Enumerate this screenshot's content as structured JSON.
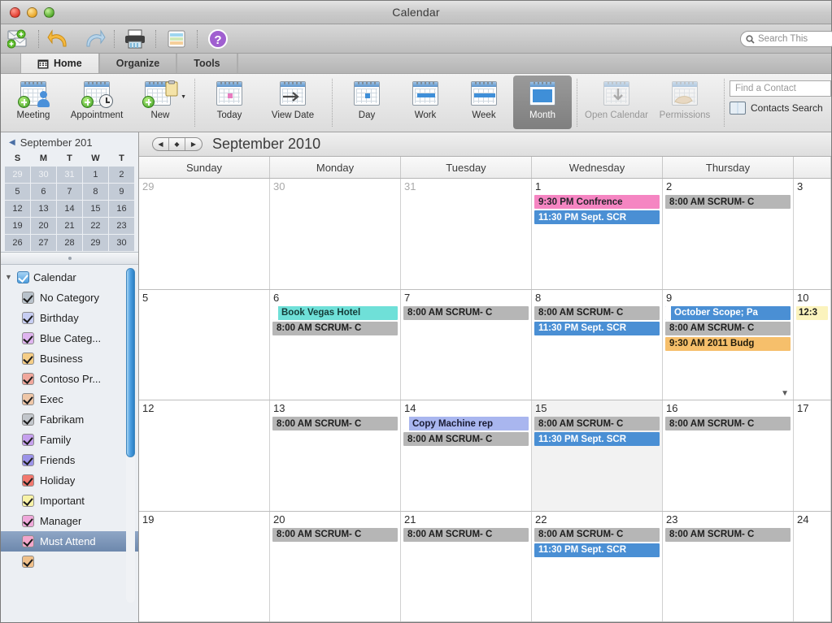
{
  "window": {
    "title": "Calendar",
    "traffic_lights": [
      "close-button",
      "minimize-button",
      "zoom-button"
    ]
  },
  "quick_toolbar": {
    "items": [
      {
        "name": "send-receive-icon",
        "label": "Send / Receive"
      },
      {
        "name": "undo-icon",
        "label": "Undo"
      },
      {
        "name": "redo-icon",
        "label": "Redo"
      },
      {
        "name": "print-icon",
        "label": "Print"
      },
      {
        "name": "categories-icon",
        "label": "Categories"
      },
      {
        "name": "help-icon",
        "label": "Help"
      }
    ],
    "search_placeholder": "Search This"
  },
  "tabs": [
    {
      "label": "Home",
      "active": true
    },
    {
      "label": "Organize",
      "active": false
    },
    {
      "label": "Tools",
      "active": false
    }
  ],
  "ribbon": {
    "groups": [
      {
        "items": [
          {
            "label": "Meeting",
            "icon": "new-meeting-icon",
            "state": "enabled"
          },
          {
            "label": "Appointment",
            "icon": "new-appointment-icon",
            "state": "enabled"
          },
          {
            "label": "New",
            "icon": "new-item-icon",
            "state": "enabled",
            "has_dropdown": true
          }
        ]
      },
      {
        "items": [
          {
            "label": "Today",
            "icon": "today-icon",
            "state": "enabled"
          },
          {
            "label": "View Date",
            "icon": "view-date-icon",
            "state": "enabled"
          }
        ]
      },
      {
        "items": [
          {
            "label": "Day",
            "icon": "day-view-icon",
            "state": "enabled"
          },
          {
            "label": "Work",
            "icon": "work-week-view-icon",
            "state": "enabled"
          },
          {
            "label": "Week",
            "icon": "week-view-icon",
            "state": "enabled"
          },
          {
            "label": "Month",
            "icon": "month-view-icon",
            "state": "selected"
          }
        ]
      },
      {
        "items": [
          {
            "label": "Open Calendar",
            "icon": "open-calendar-icon",
            "state": "disabled"
          },
          {
            "label": "Permissions",
            "icon": "permissions-icon",
            "state": "disabled"
          }
        ]
      }
    ],
    "find_contact_placeholder": "Find a Contact",
    "contacts_search_label": "Contacts Search"
  },
  "sidebar": {
    "mini_calendar": {
      "title": "September 201",
      "prev_label": "◀",
      "weekday_headers": [
        "S",
        "M",
        "T",
        "W",
        "T"
      ],
      "weeks": [
        [
          {
            "d": "29",
            "other": true
          },
          {
            "d": "30",
            "other": true
          },
          {
            "d": "31",
            "other": true
          },
          {
            "d": "1"
          },
          {
            "d": "2"
          }
        ],
        [
          {
            "d": "5"
          },
          {
            "d": "6"
          },
          {
            "d": "7"
          },
          {
            "d": "8"
          },
          {
            "d": "9"
          }
        ],
        [
          {
            "d": "12"
          },
          {
            "d": "13"
          },
          {
            "d": "14"
          },
          {
            "d": "15"
          },
          {
            "d": "16"
          }
        ],
        [
          {
            "d": "19"
          },
          {
            "d": "20"
          },
          {
            "d": "21"
          },
          {
            "d": "22"
          },
          {
            "d": "23"
          }
        ],
        [
          {
            "d": "26"
          },
          {
            "d": "27"
          },
          {
            "d": "28"
          },
          {
            "d": "29"
          },
          {
            "d": "30"
          }
        ]
      ]
    },
    "root": {
      "label": "Calendar",
      "checked": true,
      "color": "#4d9ede",
      "expanded": true
    },
    "categories": [
      {
        "label": "No Category",
        "color": "#b9c2cb",
        "checked": true
      },
      {
        "label": "Birthday",
        "color": "#c6cdf2",
        "checked": true
      },
      {
        "label": "Blue Categ...",
        "color": "#dfb4ef",
        "checked": true
      },
      {
        "label": "Business",
        "color": "#f5cd86",
        "checked": true
      },
      {
        "label": "Contoso Pr...",
        "color": "#f0a79c",
        "checked": true
      },
      {
        "label": "Exec",
        "color": "#eec6a7",
        "checked": true
      },
      {
        "label": "Fabrikam",
        "color": "#c2c6cb",
        "checked": true
      },
      {
        "label": "Family",
        "color": "#c5a0ed",
        "checked": true
      },
      {
        "label": "Friends",
        "color": "#9b93e8",
        "checked": true
      },
      {
        "label": "Holiday",
        "color": "#f2786e",
        "checked": true
      },
      {
        "label": "Important",
        "color": "#f7f2a6",
        "checked": true
      },
      {
        "label": "Manager",
        "color": "#efa8da",
        "checked": true
      },
      {
        "label": "Must Attend",
        "color": "#f3a6cb",
        "checked": true,
        "selected": true
      },
      {
        "label": "",
        "color": "#f0c08a",
        "checked": true,
        "partial": true
      }
    ]
  },
  "calendar": {
    "nav_buttons": [
      "◀",
      "◆",
      "▶"
    ],
    "month_title": "September 2010",
    "day_headers": [
      "Sunday",
      "Monday",
      "Tuesday",
      "Wednesday",
      "Thursday",
      ""
    ],
    "colors": {
      "gray_event": "#b6b6b6",
      "blue_event": "#4a8fd4",
      "pink_event": "#f585c2",
      "teal_event": "#6fe0d8",
      "orange_event": "#f6bf6b",
      "lavender_event": "#a9b6ef",
      "pale_yellow_event": "#fbf3bd"
    },
    "weeks": [
      {
        "days": [
          {
            "num": "29",
            "dim": true,
            "events": []
          },
          {
            "num": "30",
            "dim": true,
            "events": []
          },
          {
            "num": "31",
            "dim": true,
            "events": []
          },
          {
            "num": "1",
            "events": [
              {
                "text": "9:30 PM Confrence",
                "style": "pink",
                "allday": false
              },
              {
                "text": "11:30 PM  Sept. SCR",
                "style": "blue",
                "allday": false
              }
            ]
          },
          {
            "num": "2",
            "events": [
              {
                "text": "8:00 AM SCRUM- C",
                "style": "gray",
                "allday": false
              }
            ]
          },
          {
            "num": "3",
            "partial": true,
            "events": []
          }
        ]
      },
      {
        "days": [
          {
            "num": "5",
            "events": []
          },
          {
            "num": "6",
            "events": [
              {
                "text": "Book Vegas Hotel",
                "style": "teal",
                "allday": true
              },
              {
                "text": "8:00 AM SCRUM- C",
                "style": "gray",
                "allday": false
              }
            ]
          },
          {
            "num": "7",
            "events": [
              {
                "text": "8:00 AM SCRUM- C",
                "style": "gray",
                "allday": false
              }
            ]
          },
          {
            "num": "8",
            "events": [
              {
                "text": "8:00 AM SCRUM- C",
                "style": "gray",
                "allday": false
              },
              {
                "text": "11:30 PM  Sept. SCR",
                "style": "blue",
                "allday": false
              }
            ]
          },
          {
            "num": "9",
            "overflow": true,
            "events": [
              {
                "text": "October Scope; Pa",
                "style": "blue",
                "allday": true
              },
              {
                "text": "8:00 AM SCRUM- C",
                "style": "gray",
                "allday": false
              },
              {
                "text": "9:30 AM 2011 Budg",
                "style": "orange",
                "allday": false
              }
            ]
          },
          {
            "num": "10",
            "partial": true,
            "events": [
              {
                "text": "12:3",
                "style": "paleyellow",
                "allday": false
              }
            ]
          }
        ]
      },
      {
        "days": [
          {
            "num": "12",
            "events": []
          },
          {
            "num": "13",
            "events": [
              {
                "text": "8:00 AM SCRUM- C",
                "style": "gray",
                "allday": false
              }
            ]
          },
          {
            "num": "14",
            "events": [
              {
                "text": "Copy Machine rep",
                "style": "lavender",
                "allday": true
              },
              {
                "text": "8:00 AM SCRUM- C",
                "style": "gray",
                "allday": false
              }
            ]
          },
          {
            "num": "15",
            "shaded": true,
            "events": [
              {
                "text": "8:00 AM SCRUM- C",
                "style": "gray",
                "allday": false
              },
              {
                "text": "11:30 PM  Sept. SCR",
                "style": "blue",
                "allday": false
              }
            ]
          },
          {
            "num": "16",
            "events": [
              {
                "text": "8:00 AM SCRUM- C",
                "style": "gray",
                "allday": false
              }
            ]
          },
          {
            "num": "17",
            "partial": true,
            "events": []
          }
        ]
      },
      {
        "days": [
          {
            "num": "19",
            "events": []
          },
          {
            "num": "20",
            "events": [
              {
                "text": "8:00 AM SCRUM- C",
                "style": "gray",
                "allday": false
              }
            ]
          },
          {
            "num": "21",
            "events": [
              {
                "text": "8:00 AM SCRUM- C",
                "style": "gray",
                "allday": false
              }
            ]
          },
          {
            "num": "22",
            "events": [
              {
                "text": "8:00 AM SCRUM- C",
                "style": "gray",
                "allday": false
              },
              {
                "text": "11:30 PM  Sept. SCR",
                "style": "blue",
                "allday": false
              }
            ]
          },
          {
            "num": "23",
            "events": [
              {
                "text": "8:00 AM SCRUM- C",
                "style": "gray",
                "allday": false
              }
            ]
          },
          {
            "num": "24",
            "partial": true,
            "events": []
          }
        ]
      }
    ]
  }
}
